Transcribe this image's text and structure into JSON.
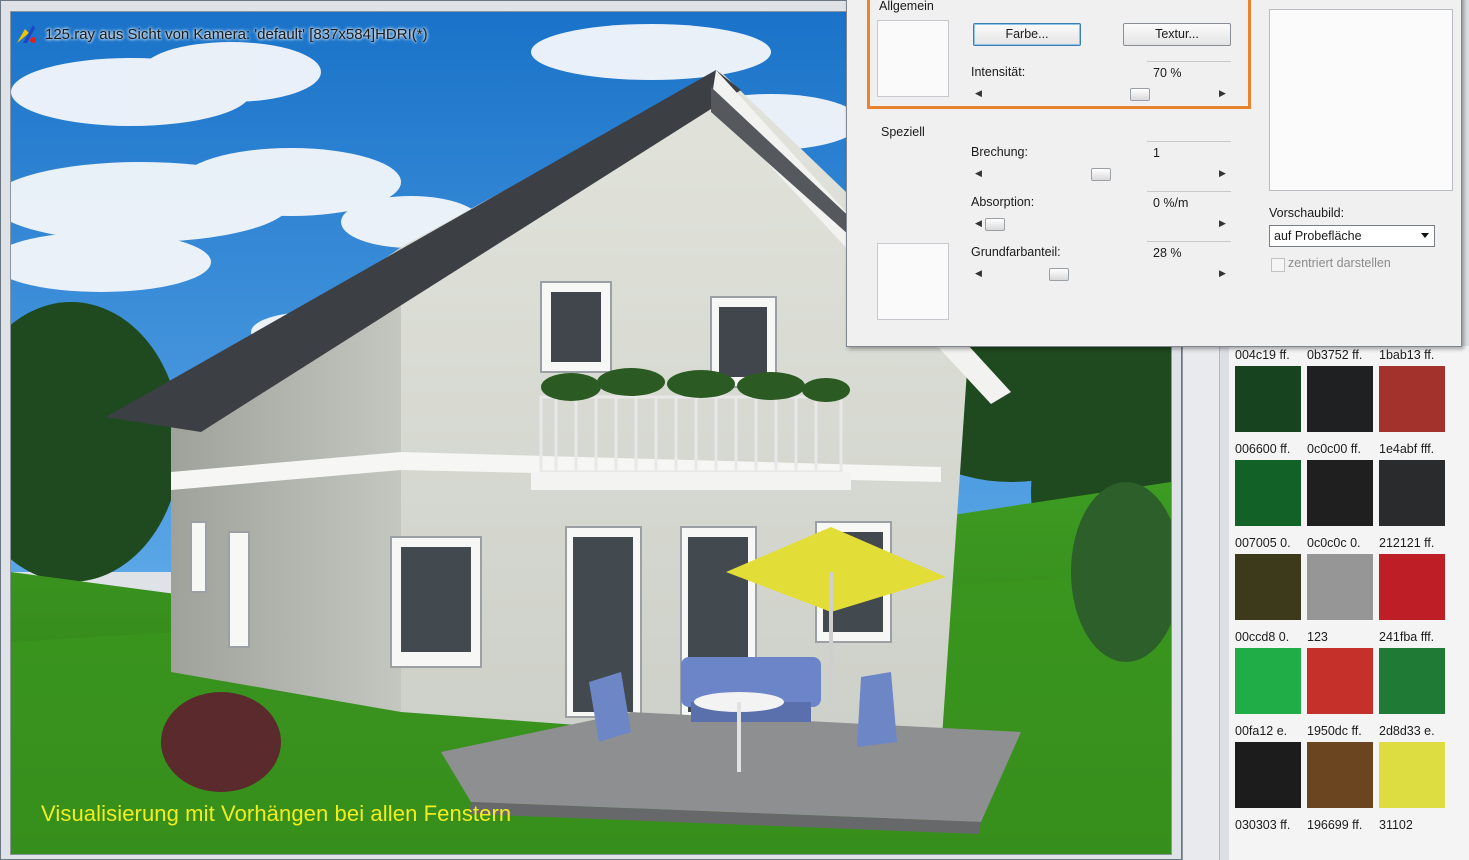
{
  "render_window": {
    "title": "125.ray aus Sicht von Kamera: 'default' [837x584]HDRI(*)",
    "caption": "Visualisierung mit Vorhängen bei allen Fenstern"
  },
  "dialog": {
    "sections": {
      "general": "Allgemein",
      "special": "Speziell"
    },
    "buttons": {
      "color": "Farbe...",
      "texture": "Textur..."
    },
    "fields": {
      "intensity": {
        "label": "Intensität:",
        "value": "70 %",
        "fraction": 0.7
      },
      "refraction": {
        "label": "Brechung:",
        "value": "1",
        "fraction": 0.55
      },
      "absorption": {
        "label": "Absorption:",
        "value": "0 %/m",
        "fraction": 0.0
      },
      "base_color_share": {
        "label": "Grundfarbanteil:",
        "value": "28 %",
        "fraction": 0.28
      }
    },
    "preview": {
      "label": "Vorschaubild:",
      "selected": "auf Probefläche",
      "centered_label": "zentriert darstellen",
      "centered_checked": false
    },
    "accent_color": "#e8842f"
  },
  "palette": {
    "rows": [
      {
        "labels": [
          "004c19 ff.",
          "0b3752 ff.",
          "1bab13 ff."
        ],
        "colors": [
          "#17441f",
          "#1e2022",
          "#a2322b"
        ]
      },
      {
        "labels": [
          "006600 ff.",
          "0c0c00 ff.",
          "1e4abf fff."
        ],
        "colors": [
          "#126227",
          "#1f1f1f",
          "#2a2b2c"
        ]
      },
      {
        "labels": [
          "007005 0.",
          "0c0c0c 0.",
          "212121 ff."
        ],
        "colors": [
          "#3d3a1c",
          "#969696",
          "#be1f26"
        ]
      },
      {
        "labels": [
          "00ccd8 0.",
          "123",
          "241fba fff."
        ],
        "colors": [
          "#20ad48",
          "#c5312a",
          "#1f7a35"
        ]
      },
      {
        "labels": [
          "00fa12 e.",
          "1950dc ff.",
          "2d8d33 e."
        ],
        "colors": [
          "#1c1c1c",
          "#6b4520",
          "#dddc41"
        ]
      },
      {
        "labels": [
          "030303 ff.",
          "196699 ff.",
          "31102"
        ],
        "colors": []
      }
    ]
  }
}
